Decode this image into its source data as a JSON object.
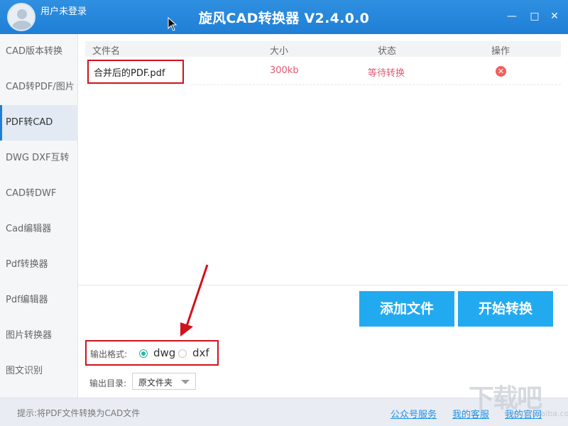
{
  "titlebar": {
    "user_label": "用户未登录",
    "app_title": "旋风CAD转换器 V2.4.0.0",
    "min_icon": "—",
    "max_icon": "□",
    "close_icon": "✕"
  },
  "sidebar": {
    "items": [
      {
        "label": "CAD版本转换"
      },
      {
        "label": "CAD转PDF/图片"
      },
      {
        "label": "PDF转CAD"
      },
      {
        "label": "DWG DXF互转"
      },
      {
        "label": "CAD转DWF"
      },
      {
        "label": "Cad编辑器"
      },
      {
        "label": "Pdf转换器"
      },
      {
        "label": "Pdf编辑器"
      },
      {
        "label": "图片转换器"
      },
      {
        "label": "图文识别"
      }
    ],
    "active_index": 2
  },
  "table": {
    "headers": {
      "name": "文件名",
      "size": "大小",
      "status": "状态",
      "action": "操作"
    },
    "rows": [
      {
        "name": "合并后的PDF.pdf",
        "size": "300kb",
        "status": "等待转换",
        "action_icon": "delete-icon"
      }
    ]
  },
  "actions": {
    "add_label": "添加文件",
    "start_label": "开始转换"
  },
  "output": {
    "format_label": "输出格式:",
    "formats": [
      {
        "label": "dwg",
        "checked": true
      },
      {
        "label": "dxf",
        "checked": false
      }
    ],
    "dir_label": "输出目录:",
    "dir_value": "原文件夹"
  },
  "statusbar": {
    "tip": "提示:将PDF文件转换为CAD文件",
    "links": [
      "公众号服务",
      "我的客服",
      "我的官网"
    ]
  },
  "watermark": {
    "text": "下载吧",
    "sub": "www.xiazaiba.com"
  },
  "colors": {
    "accent": "#1f7fd6",
    "button": "#22aaf0",
    "highlight": "#d0121b",
    "status": "#e05a73"
  }
}
